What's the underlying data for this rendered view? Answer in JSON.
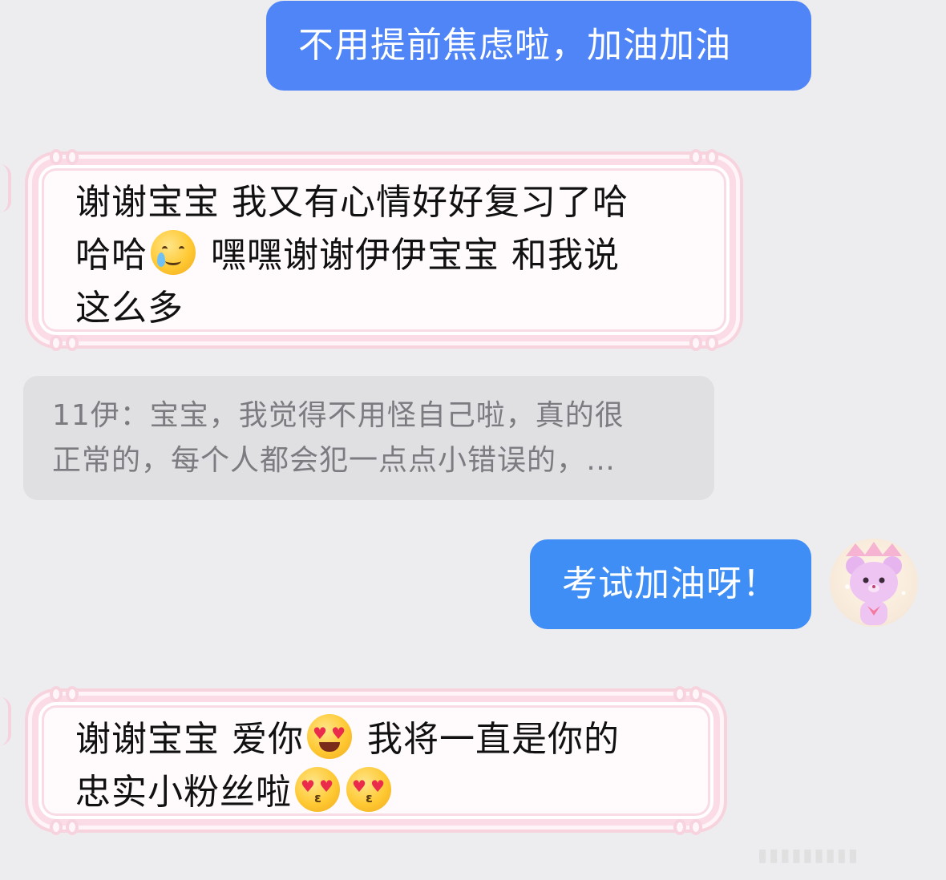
{
  "messages": {
    "m1": {
      "text": "不用提前焦虑啦，加油加油"
    },
    "m2": {
      "line1": "谢谢宝宝 我又有心情好好复习了哈",
      "line2a": "哈哈",
      "line2b": "嘿嘿谢谢伊伊宝宝 和我说",
      "line3": "这么多",
      "emoji": "crying-smile-emoji"
    },
    "quote": {
      "line1": "11伊：宝宝，我觉得不用怪自己啦，真的很",
      "line2": "正常的，每个人都会犯一点点小错误的，…"
    },
    "m3": {
      "text": "考试加油呀！"
    },
    "m4": {
      "line1a": "谢谢宝宝 爱你",
      "line1b": "我将一直是你的",
      "line2": "忠实小粉丝啦",
      "emojis": [
        "heart-eyes-emoji",
        "kissing-heart-emoji",
        "kissing-heart-emoji"
      ]
    }
  },
  "avatar": {
    "name": "pink-bear-avatar"
  },
  "colors": {
    "background": "#ededf0",
    "outgoing_bubble": "#4f85f7",
    "quote_bubble": "#e0e0e3",
    "frame_pink": "#f7d3de"
  }
}
